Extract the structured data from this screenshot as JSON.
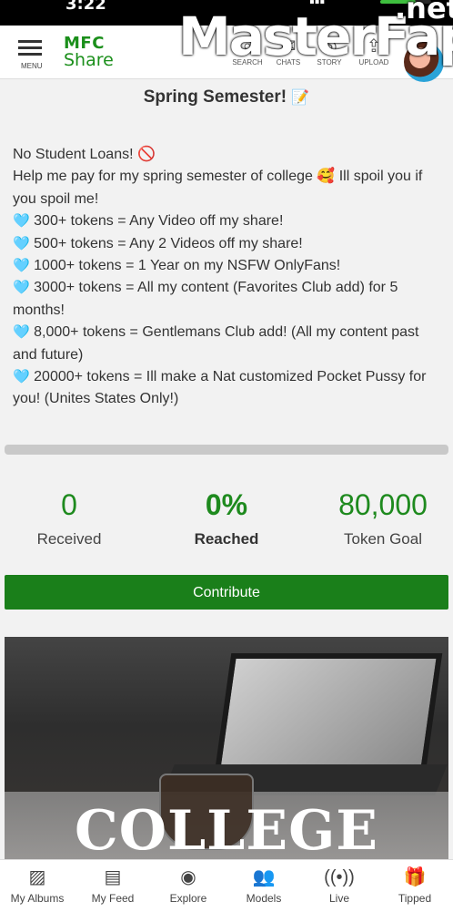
{
  "status_bar": {
    "time": "3:22",
    "signal": "▪▪▪"
  },
  "header": {
    "menu_label": "MENU",
    "logo_line1": "MFC",
    "logo_line2": "Share",
    "nav": [
      {
        "label": "SEARCH",
        "icon": "search-icon"
      },
      {
        "label": "CHATS",
        "icon": "chat-icon"
      },
      {
        "label": "STORY",
        "icon": "story-icon"
      },
      {
        "label": "UPLOAD",
        "icon": "upload-icon"
      }
    ]
  },
  "watermark": {
    "main": "MasterFap",
    "suffix": ".net"
  },
  "goal": {
    "title": "Spring Semester!",
    "title_emoji": "📝",
    "description": [
      "No Student Loans! 🚫",
      "Help me pay for my spring semester of college 🥰 Ill spoil you if you spoil me!",
      "300+ tokens = Any Video off my share!",
      "500+ tokens = Any 2 Videos off my share!",
      "1000+ tokens = 1 Year on my NSFW OnlyFans!",
      "3000+ tokens = All my content (Favorites Club add) for 5 months!",
      "8,000+ tokens = Gentlemans Club add! (All my content past and future)",
      "20000+ tokens = Ill make a Nat customized Pocket Pussy for you! (Unites States Only!)"
    ],
    "bullet_icon": "🩵",
    "progress_fraction": 0.0,
    "stats": {
      "received_value": "0",
      "received_label": "Received",
      "reached_value": "0%",
      "reached_label": "Reached",
      "goal_value": "80,000",
      "goal_label": "Token Goal"
    },
    "contribute_label": "Contribute",
    "image_text": "COLLEGE"
  },
  "bottom_nav": [
    {
      "label": "My Albums",
      "icon": "albums-icon"
    },
    {
      "label": "My Feed",
      "icon": "feed-icon"
    },
    {
      "label": "Explore",
      "icon": "compass-icon"
    },
    {
      "label": "Models",
      "icon": "models-icon"
    },
    {
      "label": "Live",
      "icon": "live-icon"
    },
    {
      "label": "Tipped",
      "icon": "gift-icon"
    }
  ],
  "colors": {
    "accent": "#1a7f1a",
    "heart": "#5ec8ef"
  }
}
